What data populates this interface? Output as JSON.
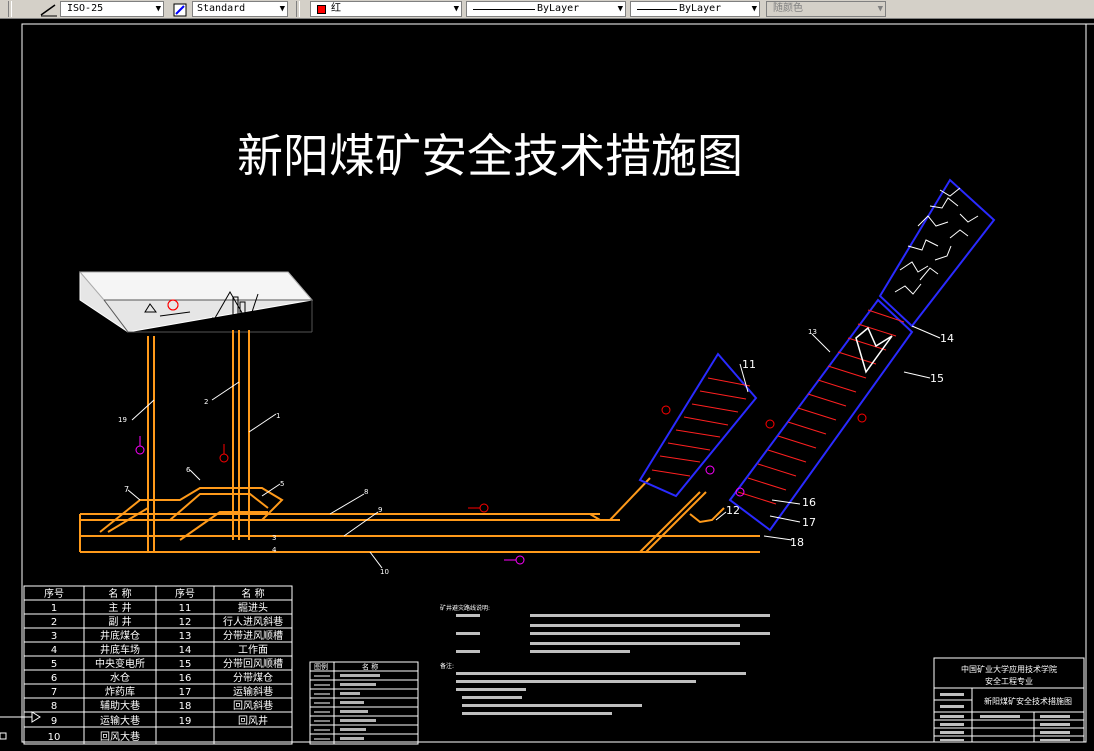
{
  "toolbar": {
    "dimstyle": "ISO-25",
    "tablestyle": "Standard",
    "color": "红",
    "linetype": "ByLayer",
    "lineweight": "ByLayer",
    "plotstyle": "随颜色"
  },
  "drawing": {
    "title": "新阳煤矿安全技术措施图",
    "callouts": [
      "1",
      "2",
      "3",
      "4",
      "5",
      "6",
      "7",
      "8",
      "9",
      "10",
      "11",
      "12",
      "13",
      "14",
      "15",
      "16",
      "17",
      "18",
      "19"
    ]
  },
  "legend": {
    "headers": [
      "序号",
      "名 称",
      "序号",
      "名 称"
    ],
    "rows": [
      [
        "1",
        "主 井",
        "11",
        "掘进头"
      ],
      [
        "2",
        "副 井",
        "12",
        "行人进风斜巷"
      ],
      [
        "3",
        "井底煤仓",
        "13",
        "分带进风顺槽"
      ],
      [
        "4",
        "井底车场",
        "14",
        "工作面"
      ],
      [
        "5",
        "中央变电所",
        "15",
        "分带回风顺槽"
      ],
      [
        "6",
        "水仓",
        "16",
        "分带煤仓"
      ],
      [
        "7",
        "炸药库",
        "17",
        "运输斜巷"
      ],
      [
        "8",
        "辅助大巷",
        "18",
        "回风斜巷"
      ],
      [
        "9",
        "运输大巷",
        "19",
        "回风井"
      ],
      [
        "10",
        "回风大巷",
        "",
        ""
      ]
    ]
  },
  "symbols": {
    "headers": [
      "图例",
      "名 称"
    ]
  },
  "notes": {
    "heading1": "矿井避灾路线说明:",
    "heading2": "备注:"
  },
  "titleblock": {
    "school": "中国矿业大学应用技术学院",
    "major": "安全工程专业",
    "drawing_name": "新阳煤矿安全技术措施图"
  }
}
